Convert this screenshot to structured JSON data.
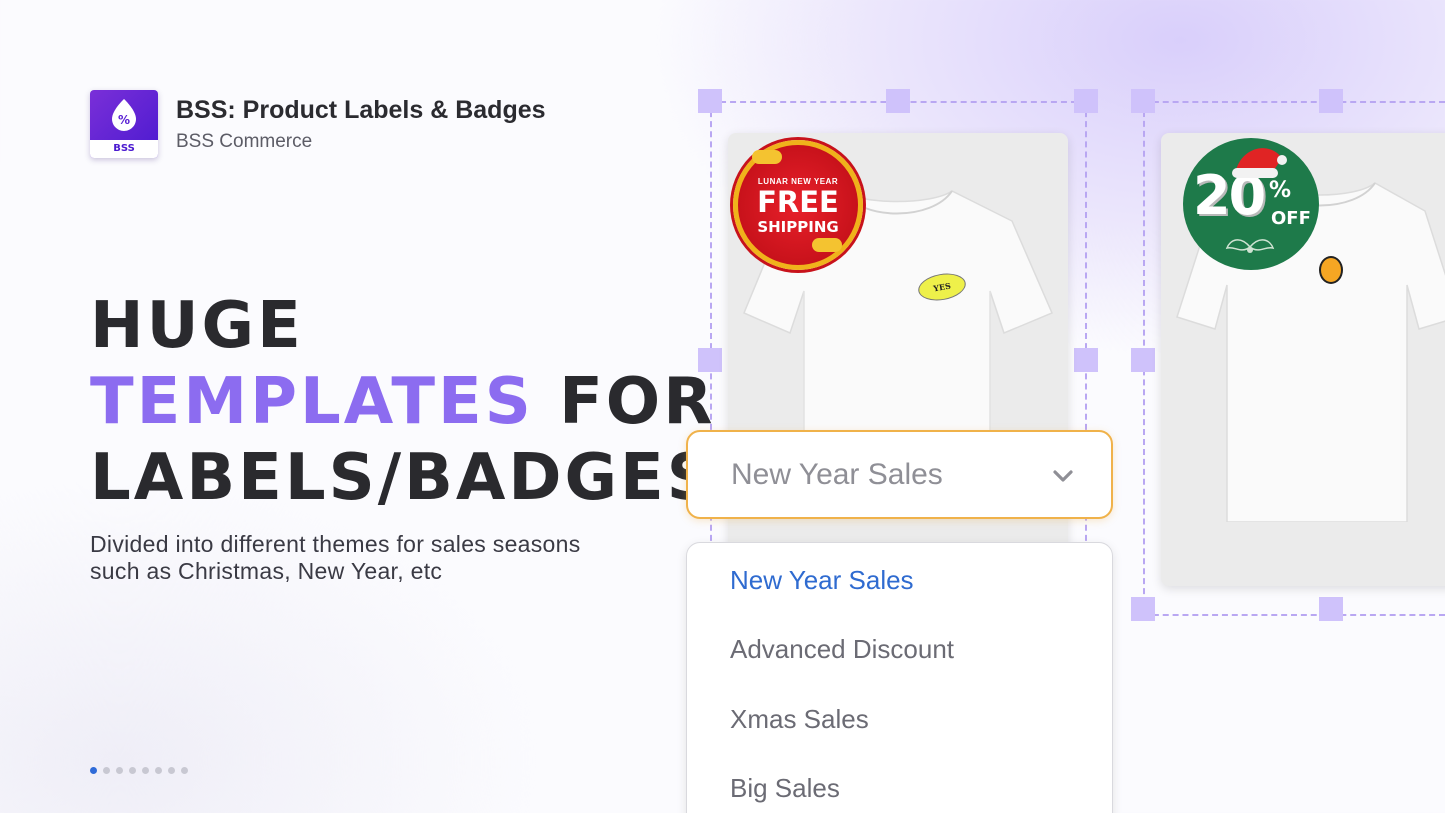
{
  "app": {
    "name": "BSS: Product Labels & Badges",
    "vendor": "BSS Commerce",
    "icon_text": "BSS",
    "icon_symbol": "%"
  },
  "headline": {
    "line1": "HUGE",
    "accent": "TEMPLATES",
    "line2_rest": " FOR",
    "line3": "LABELS/BADGES"
  },
  "subtitle": "Divided into different themes for sales seasons such as Christmas, New Year, etc",
  "carousel": {
    "total": 8,
    "active_index": 0
  },
  "badges": {
    "new_year": {
      "small": "LUNAR NEW YEAR",
      "big": "FREE",
      "mid": "SHIPPING"
    },
    "yes_sticker": "YES",
    "xmas": {
      "number": "20",
      "percent": "%",
      "off": "OFF"
    }
  },
  "select": {
    "value": "New Year Sales",
    "icon": "chevron-down-icon"
  },
  "menu": {
    "options": [
      "New Year Sales",
      "Advanced Discount",
      "Xmas Sales",
      "Big Sales"
    ],
    "selected": "New Year Sales"
  },
  "colors": {
    "accent": "#8c6cf0",
    "selected_option": "#2f6bd0",
    "select_border": "#f0b24a",
    "frame": "#b9a7f2"
  }
}
